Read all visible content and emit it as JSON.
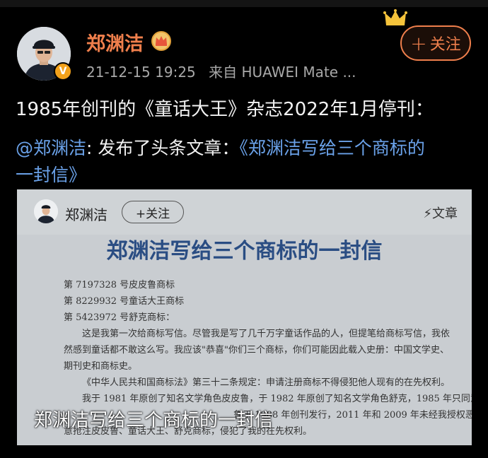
{
  "post": {
    "username": "郑渊洁",
    "timestamp": "21-12-15 19:25",
    "source": "来自 HUAWEI Mate ...",
    "follow_label": "关注",
    "verified_badge": "V",
    "text": "1985年创刊的《童话大王》杂志2022年1月停刊：",
    "share": {
      "mention": "@郑渊洁",
      "action": ": 发布了头条文章：",
      "link_part1": "《郑渊洁写给三个商标的",
      "link_part2": "一封信》"
    }
  },
  "card": {
    "username": "郑渊洁",
    "follow_label": "+关注",
    "article_label": "文章",
    "title": "郑渊洁写给三个商标的一封信",
    "doc_lines": [
      "第 7197328 号皮皮鲁商标",
      "第 8229932 号童话大王商标",
      "第 5423972 号舒克商标：",
      "这是我第一次给商标写信。尽管我是写了几千万字童话作品的人，但提笔给商标写信，我依",
      "然感到童话都不敢这么写。我应该\"恭喜\"你们三个商标，你们可能因此载入史册：中国文学史、",
      "期刊史和商标史。",
      "《中华人民共和国商标法》第三十二条规定：申请注册商标不得侵犯他人现有的在先权利。",
      "我于 1981 年原创了知名文学角色皮皮鲁，于 1982 年原创了知名文学角色舒克，1985 年只同意我",
      "鲁于 1988 年创刊发行，2011 年和 2009 年未经我授权恶",
      "意抢注皮皮鲁、童话大王、舒克商标，侵犯了我的在先权利。"
    ],
    "caption": "郑渊洁写给三个商标的一封信"
  },
  "colors": {
    "accent": "#ef7f4c",
    "link": "#6aa1e8",
    "background": "#000000",
    "meta": "#a8a8a8"
  },
  "icons": [
    "vip-crown-icon",
    "verified-v-icon",
    "follow-plus-icon",
    "lightning-icon",
    "gold-crown-icon"
  ]
}
